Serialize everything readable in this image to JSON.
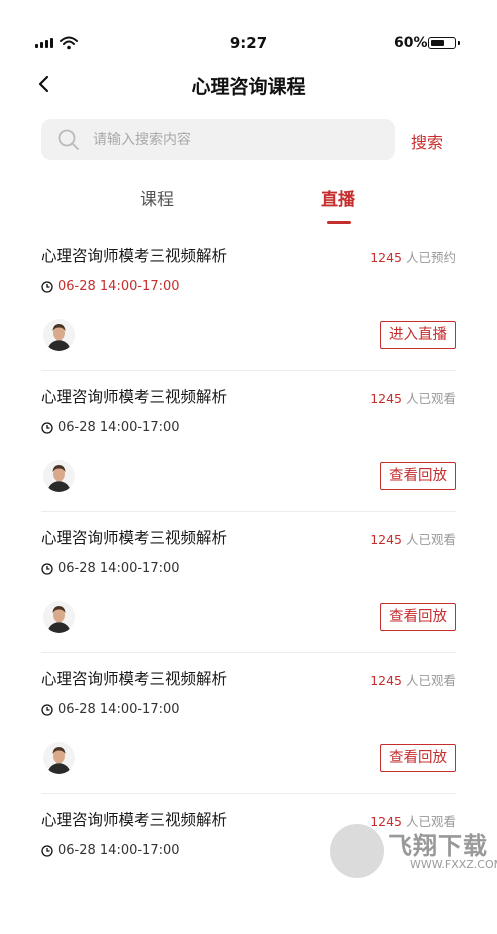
{
  "status_bar": {
    "time": "9:27",
    "battery": "60%",
    "battery_level": 0.6
  },
  "header": {
    "title": "心理咨询课程"
  },
  "search": {
    "placeholder": "请输入搜索内容",
    "value": "",
    "button_label": "搜索"
  },
  "tabs": [
    {
      "label": "课程",
      "active": false
    },
    {
      "label": "直播",
      "active": true
    }
  ],
  "colors": {
    "accent": "#c62d2d",
    "search_bg": "#f1f1f1",
    "divider": "#ececec"
  },
  "items": [
    {
      "title": "心理咨询师模考三视频解析",
      "count": "1245",
      "count_label": "人已预约",
      "time": "06-28  14:00-17:00",
      "action": "进入直播",
      "highlight_time": true
    },
    {
      "title": "心理咨询师模考三视频解析",
      "count": "1245",
      "count_label": "人已观看",
      "time": "06-28  14:00-17:00",
      "action": "查看回放",
      "highlight_time": false
    },
    {
      "title": "心理咨询师模考三视频解析",
      "count": "1245",
      "count_label": "人已观看",
      "time": "06-28  14:00-17:00",
      "action": "查看回放",
      "highlight_time": false
    },
    {
      "title": "心理咨询师模考三视频解析",
      "count": "1245",
      "count_label": "人已观看",
      "time": "06-28  14:00-17:00",
      "action": "查看回放",
      "highlight_time": false
    },
    {
      "title": "心理咨询师模考三视频解析",
      "count": "1245",
      "count_label": "人已观看",
      "time": "06-28  14:00-17:00",
      "action": "",
      "highlight_time": false
    }
  ],
  "watermark": {
    "text": "飞翔下载",
    "sub": "WWW.FXXZ.COM"
  }
}
